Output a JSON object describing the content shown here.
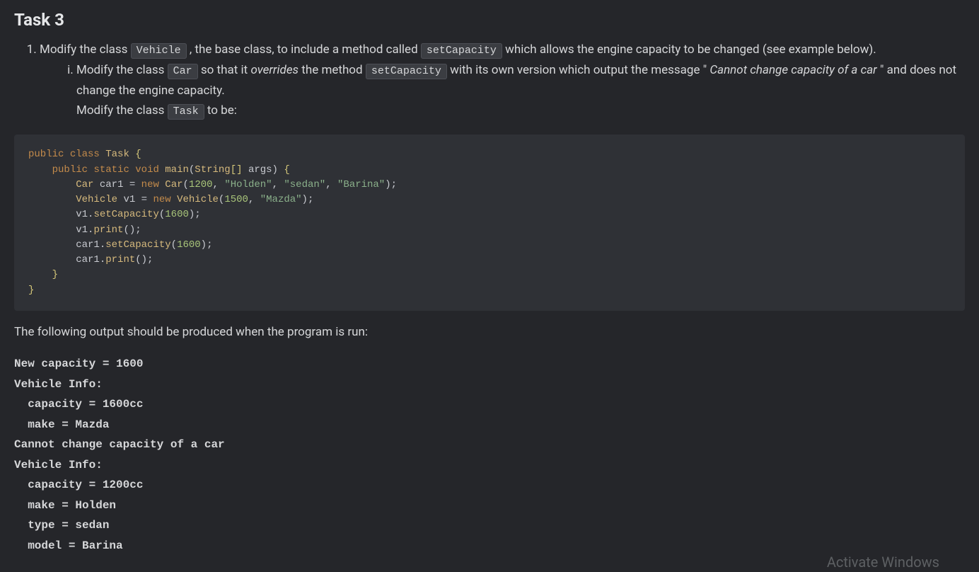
{
  "title": "Task 3",
  "list1": {
    "pre": "Modify the class ",
    "code1": "Vehicle",
    "mid1": " , the base class, to include a method called ",
    "code2": "setCapacity",
    "post": " which allows the engine capacity to be changed (see example below)."
  },
  "sub1": {
    "pre": "Modify the class ",
    "code1": "Car",
    "mid1": " so that it ",
    "em1": "overrides",
    "mid2": " the method ",
    "code2": "setCapacity",
    "mid3": " with its own version which output the message \"",
    "em2": "Cannot change capacity of a car",
    "mid4": "\" and does not change the engine capacity."
  },
  "sub2": {
    "pre": "Modify the class ",
    "code1": "Task",
    "post": " to be:"
  },
  "code": {
    "t": {
      "public": "public",
      "class": "class",
      "Task": "Task",
      "static": "static",
      "void": "void",
      "main": "main",
      "String": "String",
      "args": "args",
      "Car": "Car",
      "car1": "car1",
      "new": "new",
      "n1200": "1200",
      "Holden": "\"Holden\"",
      "sedan": "\"sedan\"",
      "Barina": "\"Barina\"",
      "Vehicle": "Vehicle",
      "v1": "v1",
      "n1500": "1500",
      "Mazda": "\"Mazda\"",
      "setCapacity": "setCapacity",
      "n1600": "1600",
      "print": "print"
    }
  },
  "outro": "The following output should be produced when the program is run:",
  "output": "New capacity = 1600\nVehicle Info:\n  capacity = 1600cc\n  make = Mazda\nCannot change capacity of a car\nVehicle Info:\n  capacity = 1200cc\n  make = Holden\n  type = sedan\n  model = Barina",
  "watermark": "Activate Windows"
}
